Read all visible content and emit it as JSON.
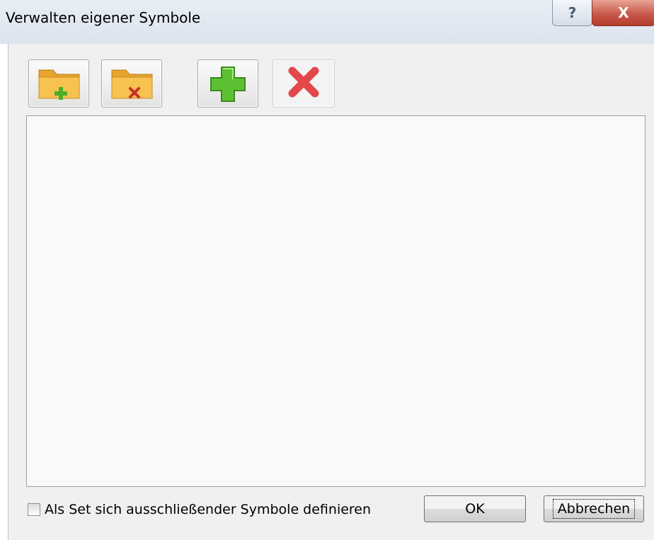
{
  "window": {
    "title": "Verwalten eigener Symbole",
    "help_glyph": "?",
    "close_glyph": "X"
  },
  "toolbar": {
    "buttons": [
      {
        "name": "new-folder",
        "icon": "folder-add-icon",
        "enabled": true
      },
      {
        "name": "delete-folder",
        "icon": "folder-delete-icon",
        "enabled": true
      },
      {
        "name": "add-symbol",
        "icon": "plus-icon",
        "enabled": true
      },
      {
        "name": "remove-symbol",
        "icon": "delete-x-icon",
        "enabled": false
      }
    ]
  },
  "options": {
    "exclusive_set_label": "Als Set sich ausschließender Symbole definieren",
    "exclusive_set_checked": false
  },
  "buttons": {
    "ok_label": "OK",
    "cancel_label": "Abbrechen"
  },
  "colors": {
    "folder": "#f5b841",
    "plus": "#5cc132",
    "delete": "#e2474a"
  }
}
